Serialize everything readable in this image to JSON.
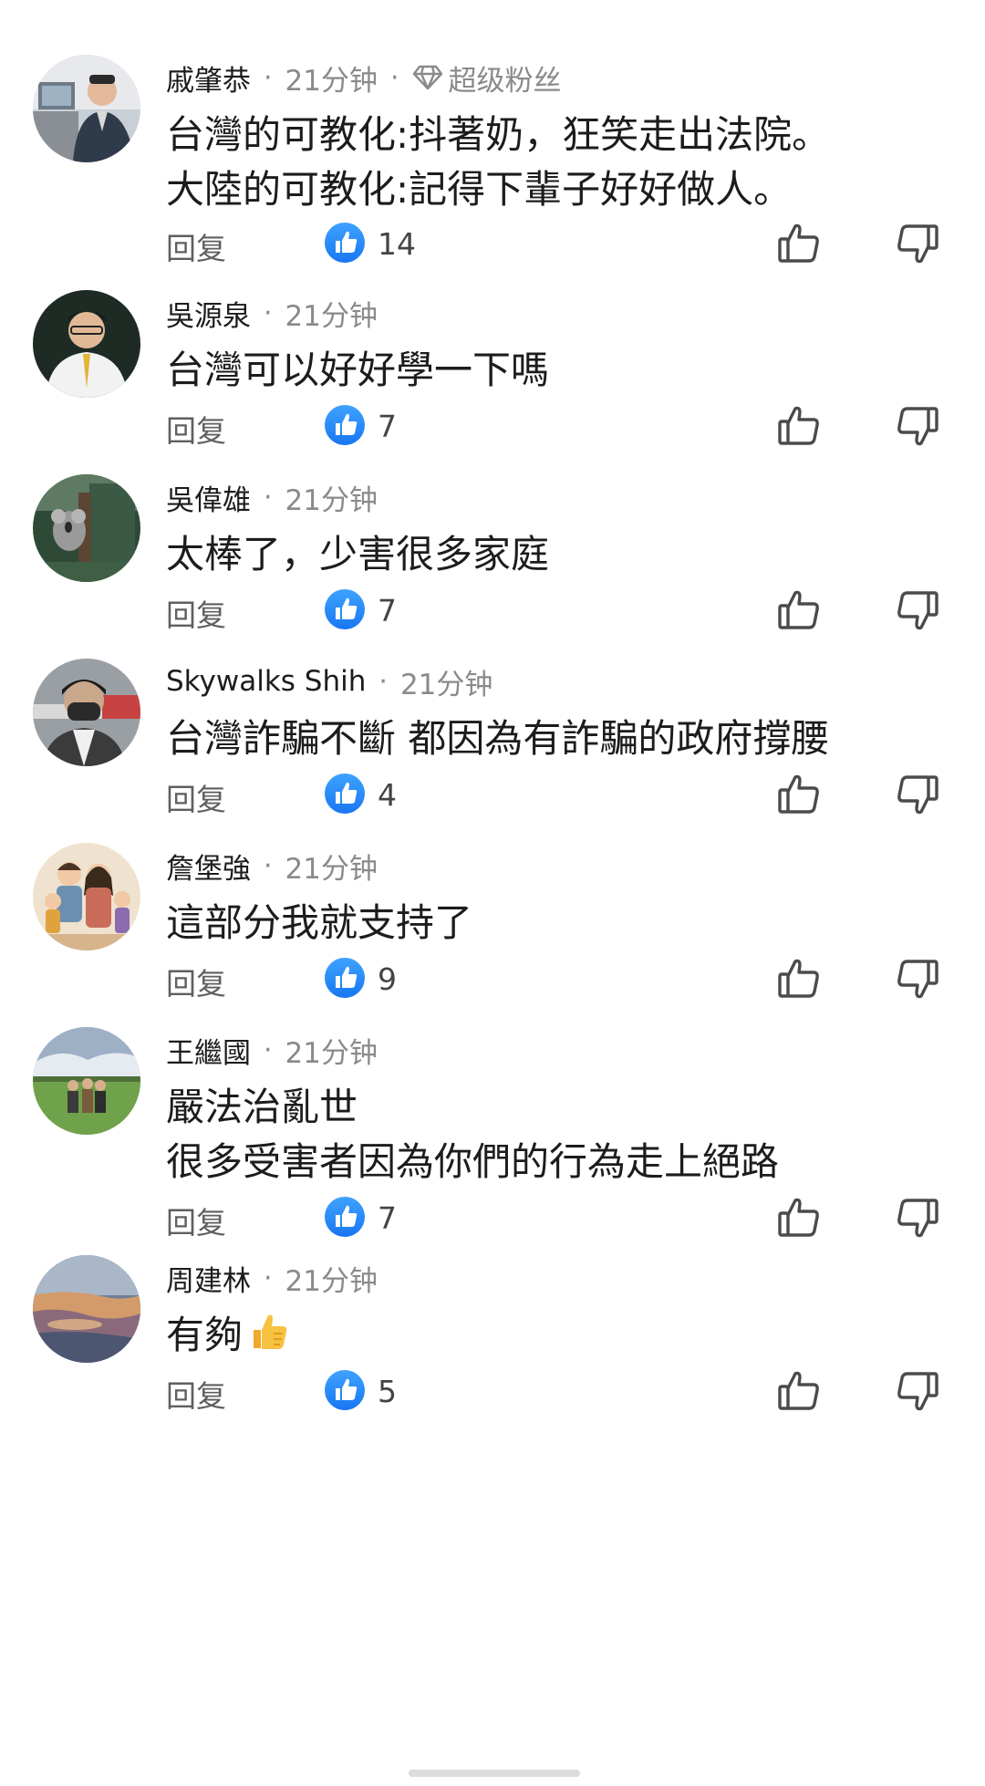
{
  "comments": [
    {
      "author": "戚肇恭",
      "time": "21分钟",
      "badge": "超级粉丝",
      "badge_icon": "diamond-icon",
      "lines": [
        "台灣的可教化:抖著奶，狂笑走出法院。",
        "大陸的可教化:記得下輩子好好做人。"
      ],
      "reply": "回复",
      "likes": "14",
      "avatar_theme": "office-man"
    },
    {
      "author": "吳源泉",
      "time": "21分钟",
      "lines": [
        "台灣可以好好學一下嗎"
      ],
      "reply": "回复",
      "likes": "7",
      "avatar_theme": "man-tie-dark"
    },
    {
      "author": "吳偉雄",
      "time": "21分钟",
      "lines": [
        "太棒了，少害很多家庭"
      ],
      "reply": "回复",
      "likes": "7",
      "avatar_theme": "koala-tree"
    },
    {
      "author": "Skywalks Shih",
      "time": "21分钟",
      "lines": [
        "台灣詐騙不斷 都因為有詐騙的政府撐腰"
      ],
      "reply": "回复",
      "likes": "4",
      "avatar_theme": "masked-man"
    },
    {
      "author": "詹堡強",
      "time": "21分钟",
      "lines": [
        "這部分我就支持了"
      ],
      "reply": "回复",
      "likes": "9",
      "avatar_theme": "family-drawing"
    },
    {
      "author": "王繼國",
      "time": "21分钟",
      "lines": [
        "嚴法治亂世",
        "很多受害者因為你們的行為走上絕路"
      ],
      "reply": "回复",
      "likes": "7",
      "avatar_theme": "field-people"
    },
    {
      "author": "周建林",
      "time": "21分钟",
      "lines": [
        "有夠"
      ],
      "emoji": "thumbs-up-emoji",
      "reply": "回复",
      "likes": "5",
      "avatar_theme": "sunset-sky"
    }
  ],
  "colors": {
    "like_blue": "#1877F2",
    "icon_gray": "#4b4b4b",
    "meta_gray": "#8a8a8a"
  }
}
